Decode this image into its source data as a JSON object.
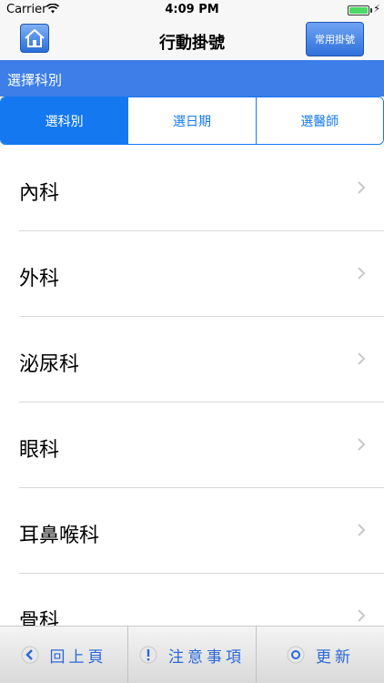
{
  "status_bar": {
    "carrier": "Carrier",
    "time": "4:09 PM"
  },
  "nav": {
    "title": "行動掛號",
    "favorite_label": "常用掛號"
  },
  "section": {
    "title": "選擇科別"
  },
  "segments": [
    {
      "label": "選科別",
      "active": true
    },
    {
      "label": "選日期",
      "active": false
    },
    {
      "label": "選醫師",
      "active": false
    }
  ],
  "departments": [
    {
      "label": "內科"
    },
    {
      "label": "外科"
    },
    {
      "label": "泌尿科"
    },
    {
      "label": "眼科"
    },
    {
      "label": "耳鼻喉科"
    },
    {
      "label": "骨科"
    }
  ],
  "toolbar": {
    "back_label": "回上頁",
    "notice_label": "注意事項",
    "refresh_label": "更新"
  },
  "colors": {
    "accent": "#1478f0",
    "section_header": "#3d7ee8",
    "toolbar_text": "#2b68d8"
  }
}
